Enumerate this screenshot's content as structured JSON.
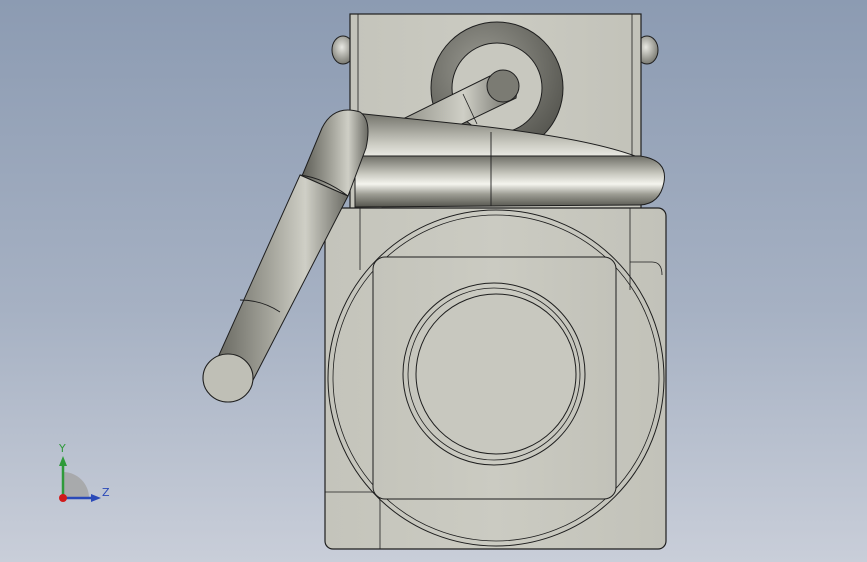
{
  "viewport": {
    "background_top": "#8c9bb2",
    "background_bottom": "#c9ced9"
  },
  "model": {
    "body_color": "#c8c8bf",
    "tube_color": "#8d8d84",
    "edge_color": "#1e1e1e"
  },
  "triad": {
    "y_label": "Y",
    "z_label": "Z",
    "y_color": "#2f9a3a",
    "z_color": "#2a49b8",
    "x_color": "#d01a1a"
  }
}
